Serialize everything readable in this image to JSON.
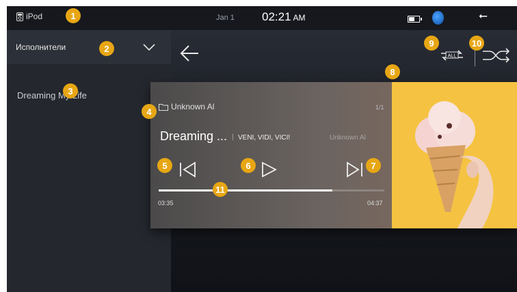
{
  "status": {
    "source": "iPod",
    "date": "Jan 1",
    "time": "02:21",
    "ampm": "AM"
  },
  "sidebar": {
    "category": "Исполнители",
    "items": [
      {
        "label": "Dreaming My Life"
      }
    ]
  },
  "player": {
    "folder": "Unknown Al",
    "track_index": "1/1",
    "title": "Dreaming ...",
    "separator": "|",
    "album": "VENI, VIDI, VICI!",
    "artist": "Unknown Al",
    "elapsed": "03:35",
    "total": "04:37",
    "progress": 0.77,
    "repeat_mode": "ALL"
  },
  "badges": [
    "1",
    "2",
    "3",
    "4",
    "5",
    "6",
    "7",
    "8",
    "9",
    "10",
    "11"
  ],
  "colors": {
    "badge": "#e7a614",
    "art_bg": "#f5c341"
  }
}
